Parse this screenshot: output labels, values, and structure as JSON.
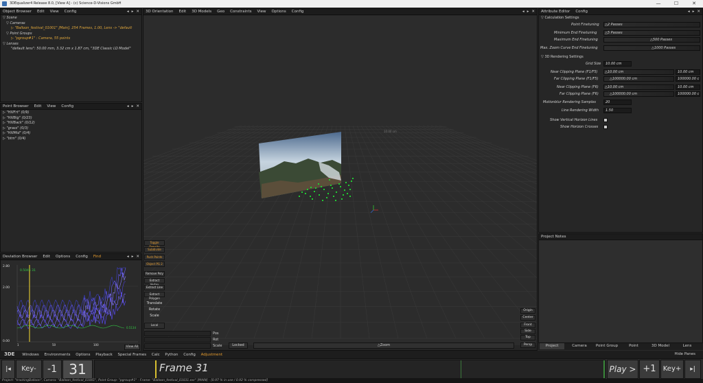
{
  "window": {
    "title": "3DEqualizer4 Release 8.0, [View A]  -  (c) Science-D-Visions GmbH",
    "minimize": "—",
    "maximize": "☐",
    "close": "✕"
  },
  "object_browser": {
    "title": "Object Browser",
    "menus": [
      "Edit",
      "View",
      "Config"
    ],
    "scene": "Scene",
    "cameras": "Cameras",
    "camera_item": "\"Balloon_festival_01001\" [Main], 254 Frames, 1.00, Lens -> \"default",
    "point_groups": "Point Groups",
    "pg_item": "\"pgroup#1\" : Camera, 55 points",
    "lenses": "Lenses",
    "lens_item": "\"default lens\": 50.00 mm, 3.32 cm x 1.87 cm, \"3DE Classic LD Model\""
  },
  "point_browser": {
    "title": "Point Browser",
    "menus": [
      "Edit",
      "View",
      "Config"
    ],
    "items": [
      "\"HillFrt\" (0/9)",
      "\"HillBig\" (0/23)",
      "\"HillBack\" (0/12)",
      "\"grass\" (0/3)",
      "\"HillMid\" (0/4)",
      "\"btm\" (0/4)"
    ]
  },
  "deviation_browser": {
    "title": "Deviation Browser",
    "menus": [
      "Edit",
      "Options",
      "Config"
    ],
    "find": "Find",
    "y_top": "2.80",
    "y_mid": "2.00",
    "y_bot": "0.00",
    "x0": "1",
    "x1": "50",
    "x2": "100",
    "marker": "0.5045 31",
    "avg": "0.5134",
    "view_all": "View All"
  },
  "view3d": {
    "menus": [
      "3D Orientation",
      "Edit",
      "3D Models",
      "Geo",
      "Constraints",
      "View",
      "Options",
      "Config"
    ],
    "grid_label": "10.00 cm",
    "tools": [
      "Toggle Density",
      "Subdivide",
      "Push Points",
      "Object PG 2"
    ],
    "tools2": [
      "Remove Poly",
      "Extract Vertex",
      "Extract Line",
      "Extract Polygon"
    ],
    "transforms": [
      "Translate",
      "Rotate",
      "Scale"
    ],
    "local": "Local",
    "pos": "Pos",
    "rot": "Rot",
    "scale": "Scale",
    "locked": "Locked",
    "zoom": "△Zoom",
    "origin": "Origin",
    "center": "Center",
    "front": "Front",
    "side": "Side",
    "top": "Top",
    "persp": "Persp"
  },
  "attribute_editor": {
    "title": "Attribute Editor",
    "config": "Config",
    "calc_section": "Calculation Settings",
    "point_finetuning": "Point Finetuning",
    "point_finetuning_val": "△2 Passes",
    "min_end": "Minimum End Finetuning",
    "min_end_val": "△5 Passes",
    "max_end": "Maximum End Finetuning",
    "max_end_val": "△500 Passes",
    "max_zoom": "Max. Zoom Curve End Finetuning",
    "max_zoom_val": "△1000 Passes",
    "render_section": "3D Rendering Settings",
    "grid_size": "Grid Size",
    "grid_size_val": "10.00 cm",
    "near_f1": "Near Clipping Plane (F1/F5)",
    "near_f1_val": "△10.00 cm",
    "near_f1_val2": "10.00 cm",
    "far_f1": "Far Clipping Plane (F1/F5)",
    "far_f1_val": "△100000.00 cm",
    "far_f1_val2": "100000.00 c",
    "near_f6": "Near Clipping Plane (F6)",
    "near_f6_val": "△10.00 cm",
    "near_f6_val2": "10.00 cm",
    "far_f6": "Far Clipping Plane (F6)",
    "far_f6_val": "△100000.00 cm",
    "far_f6_val2": "100000.00 c",
    "motionblur": "Motionblur Rendering Samples",
    "motionblur_val": "20",
    "line_width": "Line Rendering Width",
    "line_width_val": "1.50",
    "vert_horizon": "Show Vertical Horizon Lines",
    "horizon_cross": "Show Horizon Crosses",
    "project_notes": "Project Notes",
    "tabs": [
      "Project",
      "Camera",
      "Point Group",
      "Point",
      "3D Model",
      "Lens"
    ]
  },
  "menubar": {
    "logo": "3DE",
    "items": [
      "Windows",
      "Environments",
      "Options",
      "Playback",
      "Special Frames",
      "Calc",
      "Python",
      "Config"
    ],
    "adjustment": "Adjustment",
    "hide_panes": "Hide Panes"
  },
  "timeline": {
    "first": "|◂",
    "key_prev": "Key-",
    "minus1": "-1",
    "frame_num": "31",
    "frame_label": "Frame 31",
    "play": "Play >",
    "plus1": "+1",
    "key_next": "Key+",
    "last": "▸|"
  },
  "status": {
    "text": "Project: \"trackingBalloon\", Camera: \"Balloon_festival_01001\", Point Group: \"pgroup#1\" - Frame: \"Balloon_festival_01031.exr\" [MAIN] - [0.97 % in use / 0.92 % compressed]"
  },
  "colors": {
    "accent_orange": "#e3a93c",
    "point_green": "#22cc33",
    "graph_blue": "#6a5cff",
    "frame_marker": "#d8c030"
  }
}
